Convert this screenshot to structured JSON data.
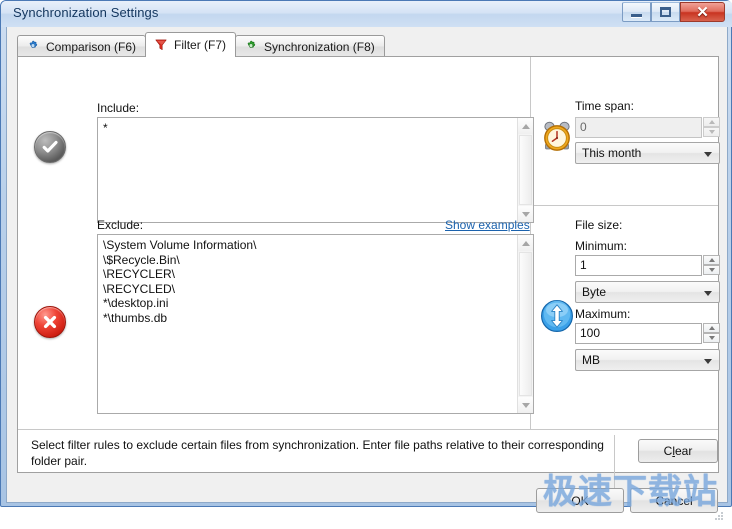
{
  "window": {
    "title": "Synchronization Settings",
    "controls": {
      "minimize": "Minimize",
      "maximize": "Restore",
      "close": "Close"
    }
  },
  "tabs": [
    {
      "label": "Comparison (F6)",
      "icon": "blue-gear-icon",
      "active": false
    },
    {
      "label": "Filter (F7)",
      "icon": "red-funnel-icon",
      "active": true
    },
    {
      "label": "Synchronization (F8)",
      "icon": "green-gear-icon",
      "active": false
    }
  ],
  "filter": {
    "include": {
      "label": "Include:",
      "icon": "gray-checkmark-icon",
      "value": "*"
    },
    "exclude": {
      "label": "Exclude:",
      "icon": "red-cross-icon",
      "link": "Show examples",
      "value": "\\System Volume Information\\\n\\$Recycle.Bin\\\n\\RECYCLER\\\n\\RECYCLED\\\n*\\desktop.ini\n*\\thumbs.db"
    }
  },
  "timespan": {
    "label": "Time span:",
    "icon": "alarm-clock-icon",
    "value": "0",
    "unit": "This month"
  },
  "filesize": {
    "label": "File size:",
    "icon": "blue-updown-arrow-icon",
    "minimum_label": "Minimum:",
    "minimum_value": "1",
    "minimum_unit": "Byte",
    "maximum_label": "Maximum:",
    "maximum_value": "100",
    "maximum_unit": "MB"
  },
  "footer": {
    "description": "Select filter rules to exclude certain files from synchronization. Enter file paths relative to their corresponding folder pair.",
    "clear_button": {
      "prefix": "C",
      "accel": "l",
      "suffix": "ear"
    }
  },
  "dialog_buttons": {
    "ok": "OK",
    "cancel": "Cancel"
  },
  "watermark": "极速下载站"
}
